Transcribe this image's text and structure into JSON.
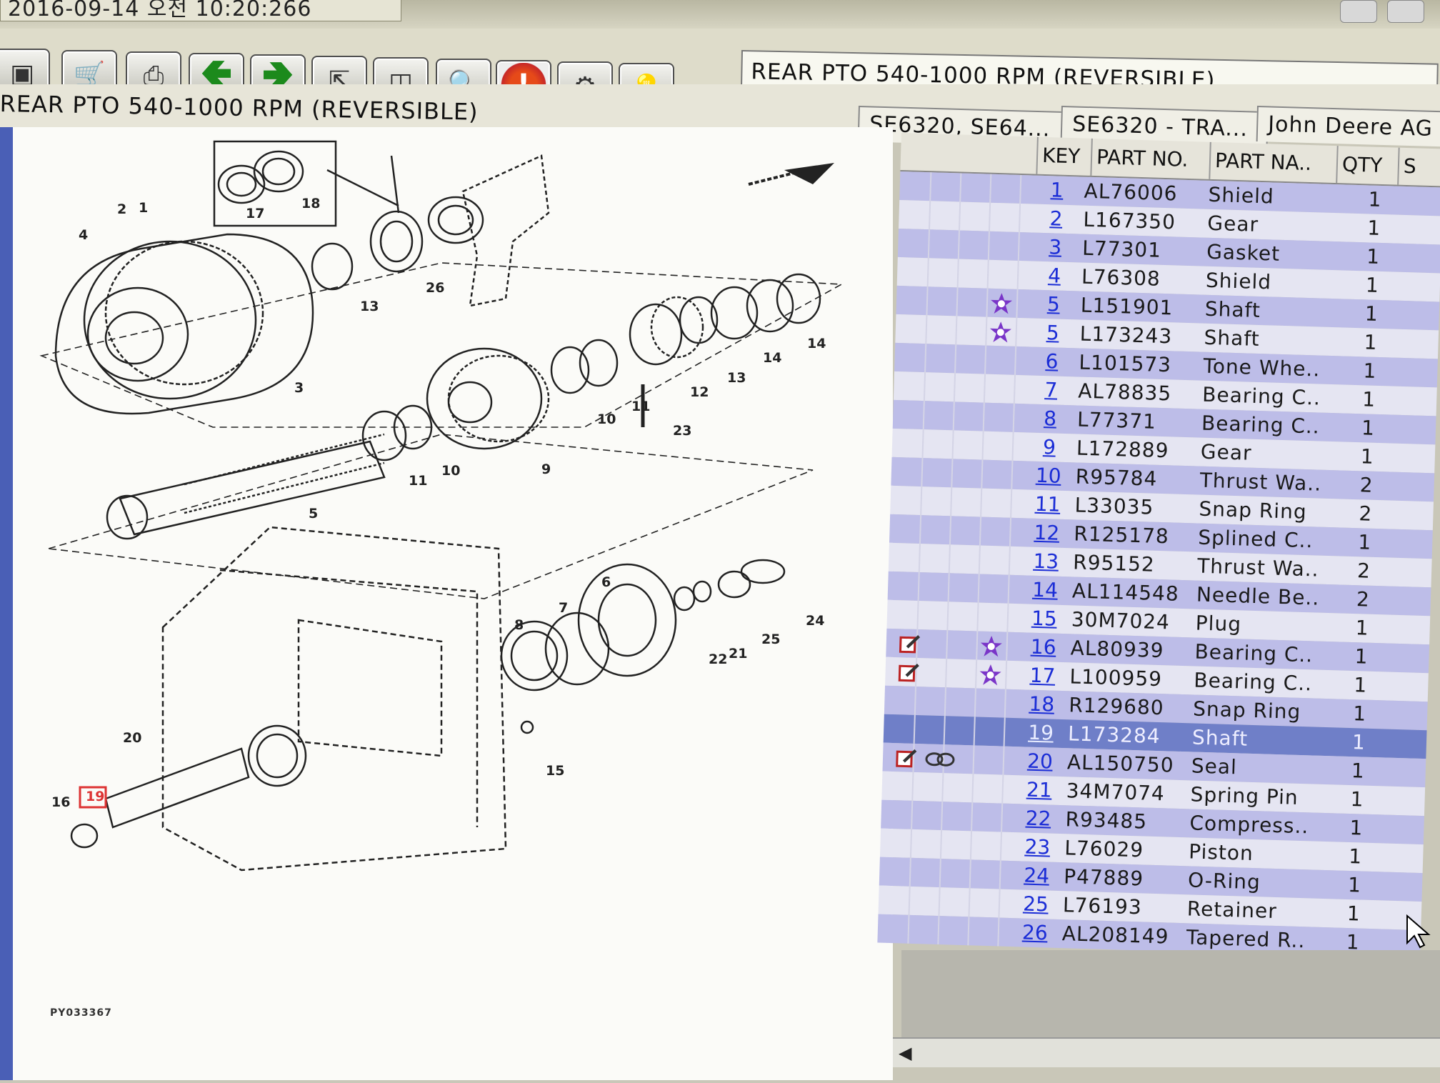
{
  "window": {
    "title_fragment": "2016-09-14 오전 10:20:266"
  },
  "toolbar": {
    "buttons": [
      {
        "icon": "parts-book-icon"
      },
      {
        "icon": "cart-icon"
      },
      {
        "icon": "print-icon"
      },
      {
        "icon": "back-arrow-icon"
      },
      {
        "icon": "forward-arrow-icon"
      },
      {
        "icon": "fit-view-icon"
      },
      {
        "icon": "split-view-icon"
      },
      {
        "icon": "zoom-icon"
      },
      {
        "icon": "alert-icon"
      },
      {
        "icon": "settings-icon"
      },
      {
        "icon": "lightbulb-icon"
      }
    ],
    "title_box": "REAR PTO 540-1000 RPM (REVERSIBLE)"
  },
  "section": {
    "title": "REAR PTO 540-1000 RPM (REVERSIBLE)",
    "breadcrumbs": [
      "SE6320, SE64...",
      "SE6320 - TRA...",
      "John Deere AG"
    ]
  },
  "diagram": {
    "drawing_code": "PY033367",
    "callouts": [
      "1",
      "2",
      "3",
      "4",
      "5",
      "6",
      "7",
      "8",
      "9",
      "10",
      "10",
      "11",
      "11",
      "12",
      "13",
      "13",
      "14",
      "14",
      "15",
      "16",
      "17",
      "18",
      "19",
      "20",
      "21",
      "22",
      "23",
      "24",
      "25",
      "26"
    ]
  },
  "parts_table": {
    "headers": {
      "key": "KEY",
      "part_no": "PART NO.",
      "part_name": "PART NA..",
      "qty": "QTY",
      "extra": "S"
    },
    "rows": [
      {
        "key": "1",
        "part_no": "AL76006",
        "name": "Shield",
        "qty": "1",
        "edit": false,
        "star": false,
        "link": false
      },
      {
        "key": "2",
        "part_no": "L167350",
        "name": "Gear",
        "qty": "1",
        "edit": false,
        "star": false,
        "link": false
      },
      {
        "key": "3",
        "part_no": "L77301",
        "name": "Gasket",
        "qty": "1",
        "edit": false,
        "star": false,
        "link": false
      },
      {
        "key": "4",
        "part_no": "L76308",
        "name": "Shield",
        "qty": "1",
        "edit": false,
        "star": false,
        "link": false
      },
      {
        "key": "5",
        "part_no": "L151901",
        "name": "Shaft",
        "qty": "1",
        "edit": false,
        "star": true,
        "link": false
      },
      {
        "key": "5",
        "part_no": "L173243",
        "name": "Shaft",
        "qty": "1",
        "edit": false,
        "star": true,
        "link": false
      },
      {
        "key": "6",
        "part_no": "L101573",
        "name": "Tone Whe..",
        "qty": "1",
        "edit": false,
        "star": false,
        "link": false
      },
      {
        "key": "7",
        "part_no": "AL78835",
        "name": "Bearing C..",
        "qty": "1",
        "edit": false,
        "star": false,
        "link": false
      },
      {
        "key": "8",
        "part_no": "L77371",
        "name": "Bearing C..",
        "qty": "1",
        "edit": false,
        "star": false,
        "link": false
      },
      {
        "key": "9",
        "part_no": "L172889",
        "name": "Gear",
        "qty": "1",
        "edit": false,
        "star": false,
        "link": false
      },
      {
        "key": "10",
        "part_no": "R95784",
        "name": "Thrust Wa..",
        "qty": "2",
        "edit": false,
        "star": false,
        "link": false
      },
      {
        "key": "11",
        "part_no": "L33035",
        "name": "Snap Ring",
        "qty": "2",
        "edit": false,
        "star": false,
        "link": false
      },
      {
        "key": "12",
        "part_no": "R125178",
        "name": "Splined C..",
        "qty": "1",
        "edit": false,
        "star": false,
        "link": false
      },
      {
        "key": "13",
        "part_no": "R95152",
        "name": "Thrust Wa..",
        "qty": "2",
        "edit": false,
        "star": false,
        "link": false
      },
      {
        "key": "14",
        "part_no": "AL114548",
        "name": "Needle Be..",
        "qty": "2",
        "edit": false,
        "star": false,
        "link": false
      },
      {
        "key": "15",
        "part_no": "30M7024",
        "name": "Plug",
        "qty": "1",
        "edit": false,
        "star": false,
        "link": false
      },
      {
        "key": "16",
        "part_no": "AL80939",
        "name": "Bearing C..",
        "qty": "1",
        "edit": true,
        "star": true,
        "link": false
      },
      {
        "key": "17",
        "part_no": "L100959",
        "name": "Bearing C..",
        "qty": "1",
        "edit": true,
        "star": true,
        "link": false
      },
      {
        "key": "18",
        "part_no": "R129680",
        "name": "Snap Ring",
        "qty": "1",
        "edit": false,
        "star": false,
        "link": false
      },
      {
        "key": "19",
        "part_no": "L173284",
        "name": "Shaft",
        "qty": "1",
        "edit": false,
        "star": false,
        "link": false,
        "selected": true
      },
      {
        "key": "20",
        "part_no": "AL150750",
        "name": "Seal",
        "qty": "1",
        "edit": true,
        "star": false,
        "link": true
      },
      {
        "key": "21",
        "part_no": "34M7074",
        "name": "Spring Pin",
        "qty": "1",
        "edit": false,
        "star": false,
        "link": false
      },
      {
        "key": "22",
        "part_no": "R93485",
        "name": "Compress..",
        "qty": "1",
        "edit": false,
        "star": false,
        "link": false
      },
      {
        "key": "23",
        "part_no": "L76029",
        "name": "Piston",
        "qty": "1",
        "edit": false,
        "star": false,
        "link": false
      },
      {
        "key": "24",
        "part_no": "P47889",
        "name": "O-Ring",
        "qty": "1",
        "edit": false,
        "star": false,
        "link": false
      },
      {
        "key": "25",
        "part_no": "L76193",
        "name": "Retainer",
        "qty": "1",
        "edit": false,
        "star": false,
        "link": false
      },
      {
        "key": "26",
        "part_no": "AL208149",
        "name": "Tapered R..",
        "qty": "1",
        "edit": false,
        "star": false,
        "link": false
      }
    ]
  },
  "colors": {
    "row_odd": "#bdbde8",
    "row_even": "#e5e5f2",
    "row_selected": "#6f7fc8",
    "key_link": "#1b2dd6",
    "star": "#7a35c8",
    "edit": "#c0392b"
  }
}
